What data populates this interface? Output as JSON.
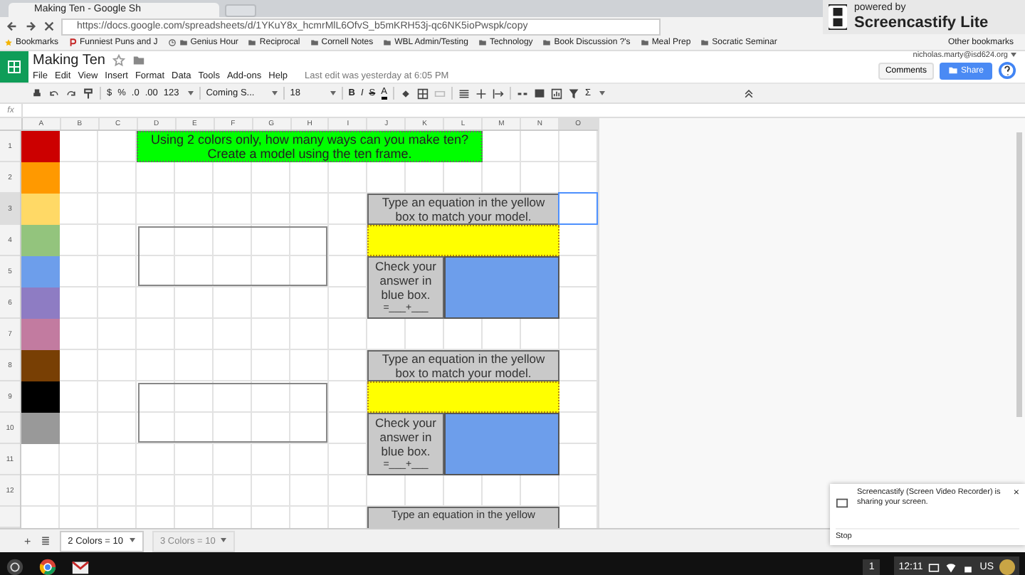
{
  "browser": {
    "tab_title": "Making Ten - Google Sh",
    "url": "https://docs.google.com/spreadsheets/d/1YKuY8x_hcmrMlL6OfvS_b5mKRH53j-qc6NK5ioPwspk/copy",
    "bookmarks": [
      {
        "kind": "star",
        "label": "Bookmarks"
      },
      {
        "kind": "letter",
        "label": "Funniest Puns and J"
      },
      {
        "kind": "clock"
      },
      {
        "kind": "folder",
        "label": "Genius Hour"
      },
      {
        "kind": "folder",
        "label": "Reciprocal"
      },
      {
        "kind": "folder",
        "label": "Cornell Notes"
      },
      {
        "kind": "folder",
        "label": "WBL Admin/Testing"
      },
      {
        "kind": "folder",
        "label": "Technology"
      },
      {
        "kind": "folder",
        "label": "Book Discussion ?'s"
      },
      {
        "kind": "folder",
        "label": "Meal Prep"
      },
      {
        "kind": "folder",
        "label": "Socratic Seminar"
      }
    ],
    "other_bookmarks": "Other bookmarks"
  },
  "overlay": {
    "small": "powered by",
    "big": "Screencastify Lite"
  },
  "doc": {
    "title": "Making Ten",
    "account": "nicholas.marty@isd624.org",
    "menu": [
      "File",
      "Edit",
      "View",
      "Insert",
      "Format",
      "Data",
      "Tools",
      "Add-ons",
      "Help"
    ],
    "last_edit": "Last edit was yesterday at 6:05 PM",
    "comments": "Comments",
    "share": "Share"
  },
  "toolbar": {
    "currency": "$",
    "percent": "%",
    "dec_less": ".0",
    "dec_more": ".00",
    "number_format": "123",
    "font": "Coming S...",
    "size": "18",
    "bold": "B",
    "italic": "I",
    "strike": "S",
    "text_color": "A",
    "functions": "Σ"
  },
  "formula_bar": {
    "label": "fx"
  },
  "sheet": {
    "columns": [
      "A",
      "B",
      "C",
      "D",
      "E",
      "F",
      "G",
      "H",
      "I",
      "J",
      "K",
      "L",
      "M",
      "N",
      "O"
    ],
    "rows": [
      "1",
      "2",
      "3",
      "4",
      "5",
      "6",
      "7",
      "8",
      "9",
      "10",
      "11",
      "12"
    ],
    "color_cells": [
      {
        "color": "#cc0000"
      },
      {
        "color": "#ff9900"
      },
      {
        "color": "#ffd966"
      },
      {
        "color": "#93c47d"
      },
      {
        "color": "#6d9eeb"
      },
      {
        "color": "#8e7cc3"
      },
      {
        "color": "#c27ba0"
      },
      {
        "color": "#783f04"
      },
      {
        "color": "#000000"
      },
      {
        "color": "#999999"
      }
    ],
    "banner": [
      "Using 2 colors only, how many ways can you make ten?",
      "Create a model using the ten frame."
    ],
    "cards": [
      {
        "title": "Type an equation in the yellow box to match your model.",
        "check": "Check your answer in blue box.",
        "blank": "=___+___"
      },
      {
        "title": "Type an equation in the yellow box to match your model.",
        "check": "Check your answer in blue box.",
        "blank": "=___+___"
      },
      {
        "title": "Type an equation in the yellow"
      }
    ]
  },
  "add_sheet": "+",
  "sheet_tabs": [
    {
      "label": "2 Colors = 10",
      "selected": true
    },
    {
      "label": "3 Colors = 10",
      "selected": false
    }
  ],
  "notification": {
    "text": "Screencastify (Screen Video Recorder) is sharing your screen.",
    "action": "Stop",
    "close": "×"
  },
  "taskbar": {
    "badge": "1",
    "time": "12:11",
    "locale": "US"
  }
}
